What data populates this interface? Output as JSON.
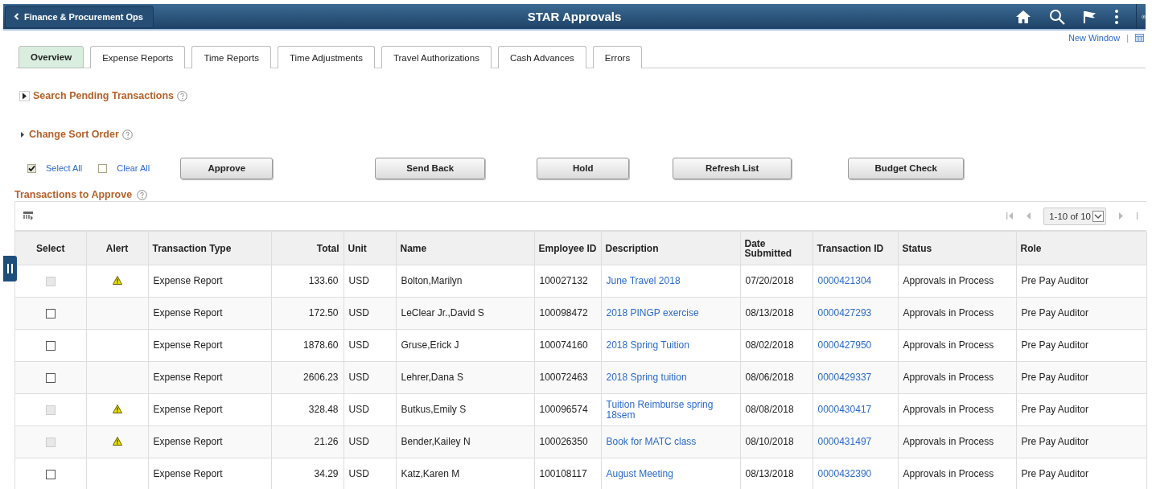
{
  "header": {
    "back_label": "Finance & Procurement Ops",
    "title": "STAR Approvals"
  },
  "links": {
    "new_window": "New Window",
    "separator": "|"
  },
  "tabs": [
    {
      "label": "Overview",
      "selected": true
    },
    {
      "label": "Expense Reports",
      "selected": false
    },
    {
      "label": "Time Reports",
      "selected": false
    },
    {
      "label": "Time Adjustments",
      "selected": false
    },
    {
      "label": "Travel Authorizations",
      "selected": false
    },
    {
      "label": "Cash Advances",
      "selected": false
    },
    {
      "label": "Errors",
      "selected": false
    }
  ],
  "sections": [
    {
      "label": "Search Pending Transactions",
      "kind": "boxed",
      "expanded": false
    },
    {
      "label": "Change Sort Order",
      "kind": "plain",
      "expanded": false
    }
  ],
  "select_all": {
    "label": "Select All",
    "checked": true
  },
  "clear_all": {
    "label": "Clear All",
    "checked": false
  },
  "buttons": [
    "Approve",
    "Send Back",
    "Hold",
    "Refresh List",
    "Budget Check"
  ],
  "grid": {
    "title": "Transactions to Approve",
    "pager": "1-10 of 10",
    "columns": [
      "Select",
      "Alert",
      "Transaction Type",
      "Total",
      "Unit",
      "Name",
      "Employee ID",
      "Description",
      "Date Submitted",
      "Transaction ID",
      "Status",
      "Role"
    ],
    "rows": [
      {
        "disabled": true,
        "alert": true,
        "type": "Expense Report",
        "total": "133.60",
        "unit": "USD",
        "name": "Bolton,Marilyn",
        "employee_id": "100027132",
        "description": "June Travel 2018",
        "date": "07/20/2018",
        "transaction_id": "0000421304",
        "status": "Approvals in Process",
        "role": "Pre Pay Auditor"
      },
      {
        "disabled": false,
        "alert": false,
        "type": "Expense Report",
        "total": "172.50",
        "unit": "USD",
        "name": "LeClear Jr.,David S",
        "employee_id": "100098472",
        "description": "2018 PINGP exercise",
        "date": "08/13/2018",
        "transaction_id": "0000427293",
        "status": "Approvals in Process",
        "role": "Pre Pay Auditor"
      },
      {
        "disabled": false,
        "alert": false,
        "type": "Expense Report",
        "total": "1878.60",
        "unit": "USD",
        "name": "Gruse,Erick J",
        "employee_id": "100074160",
        "description": "2018 Spring Tuition",
        "date": "08/02/2018",
        "transaction_id": "0000427950",
        "status": "Approvals in Process",
        "role": "Pre Pay Auditor"
      },
      {
        "disabled": false,
        "alert": false,
        "type": "Expense Report",
        "total": "2606.23",
        "unit": "USD",
        "name": "Lehrer,Dana S",
        "employee_id": "100072463",
        "description": "2018 Spring tuition",
        "date": "08/06/2018",
        "transaction_id": "0000429337",
        "status": "Approvals in Process",
        "role": "Pre Pay Auditor"
      },
      {
        "disabled": true,
        "alert": true,
        "type": "Expense Report",
        "total": "328.48",
        "unit": "USD",
        "name": "Butkus,Emily S",
        "employee_id": "100096574",
        "description": "Tuition Reimburse spring 18sem",
        "date": "08/08/2018",
        "transaction_id": "0000430417",
        "status": "Approvals in Process",
        "role": "Pre Pay Auditor"
      },
      {
        "disabled": true,
        "alert": true,
        "type": "Expense Report",
        "total": "21.26",
        "unit": "USD",
        "name": "Bender,Kailey N",
        "employee_id": "100026350",
        "description": "Book for MATC class",
        "date": "08/10/2018",
        "transaction_id": "0000431497",
        "status": "Approvals in Process",
        "role": "Pre Pay Auditor"
      },
      {
        "disabled": false,
        "alert": false,
        "type": "Expense Report",
        "total": "34.29",
        "unit": "USD",
        "name": "Katz,Karen M",
        "employee_id": "100108117",
        "description": "August Meeting",
        "date": "08/13/2018",
        "transaction_id": "0000432390",
        "status": "Approvals in Process",
        "role": "Pre Pay Auditor"
      }
    ]
  }
}
